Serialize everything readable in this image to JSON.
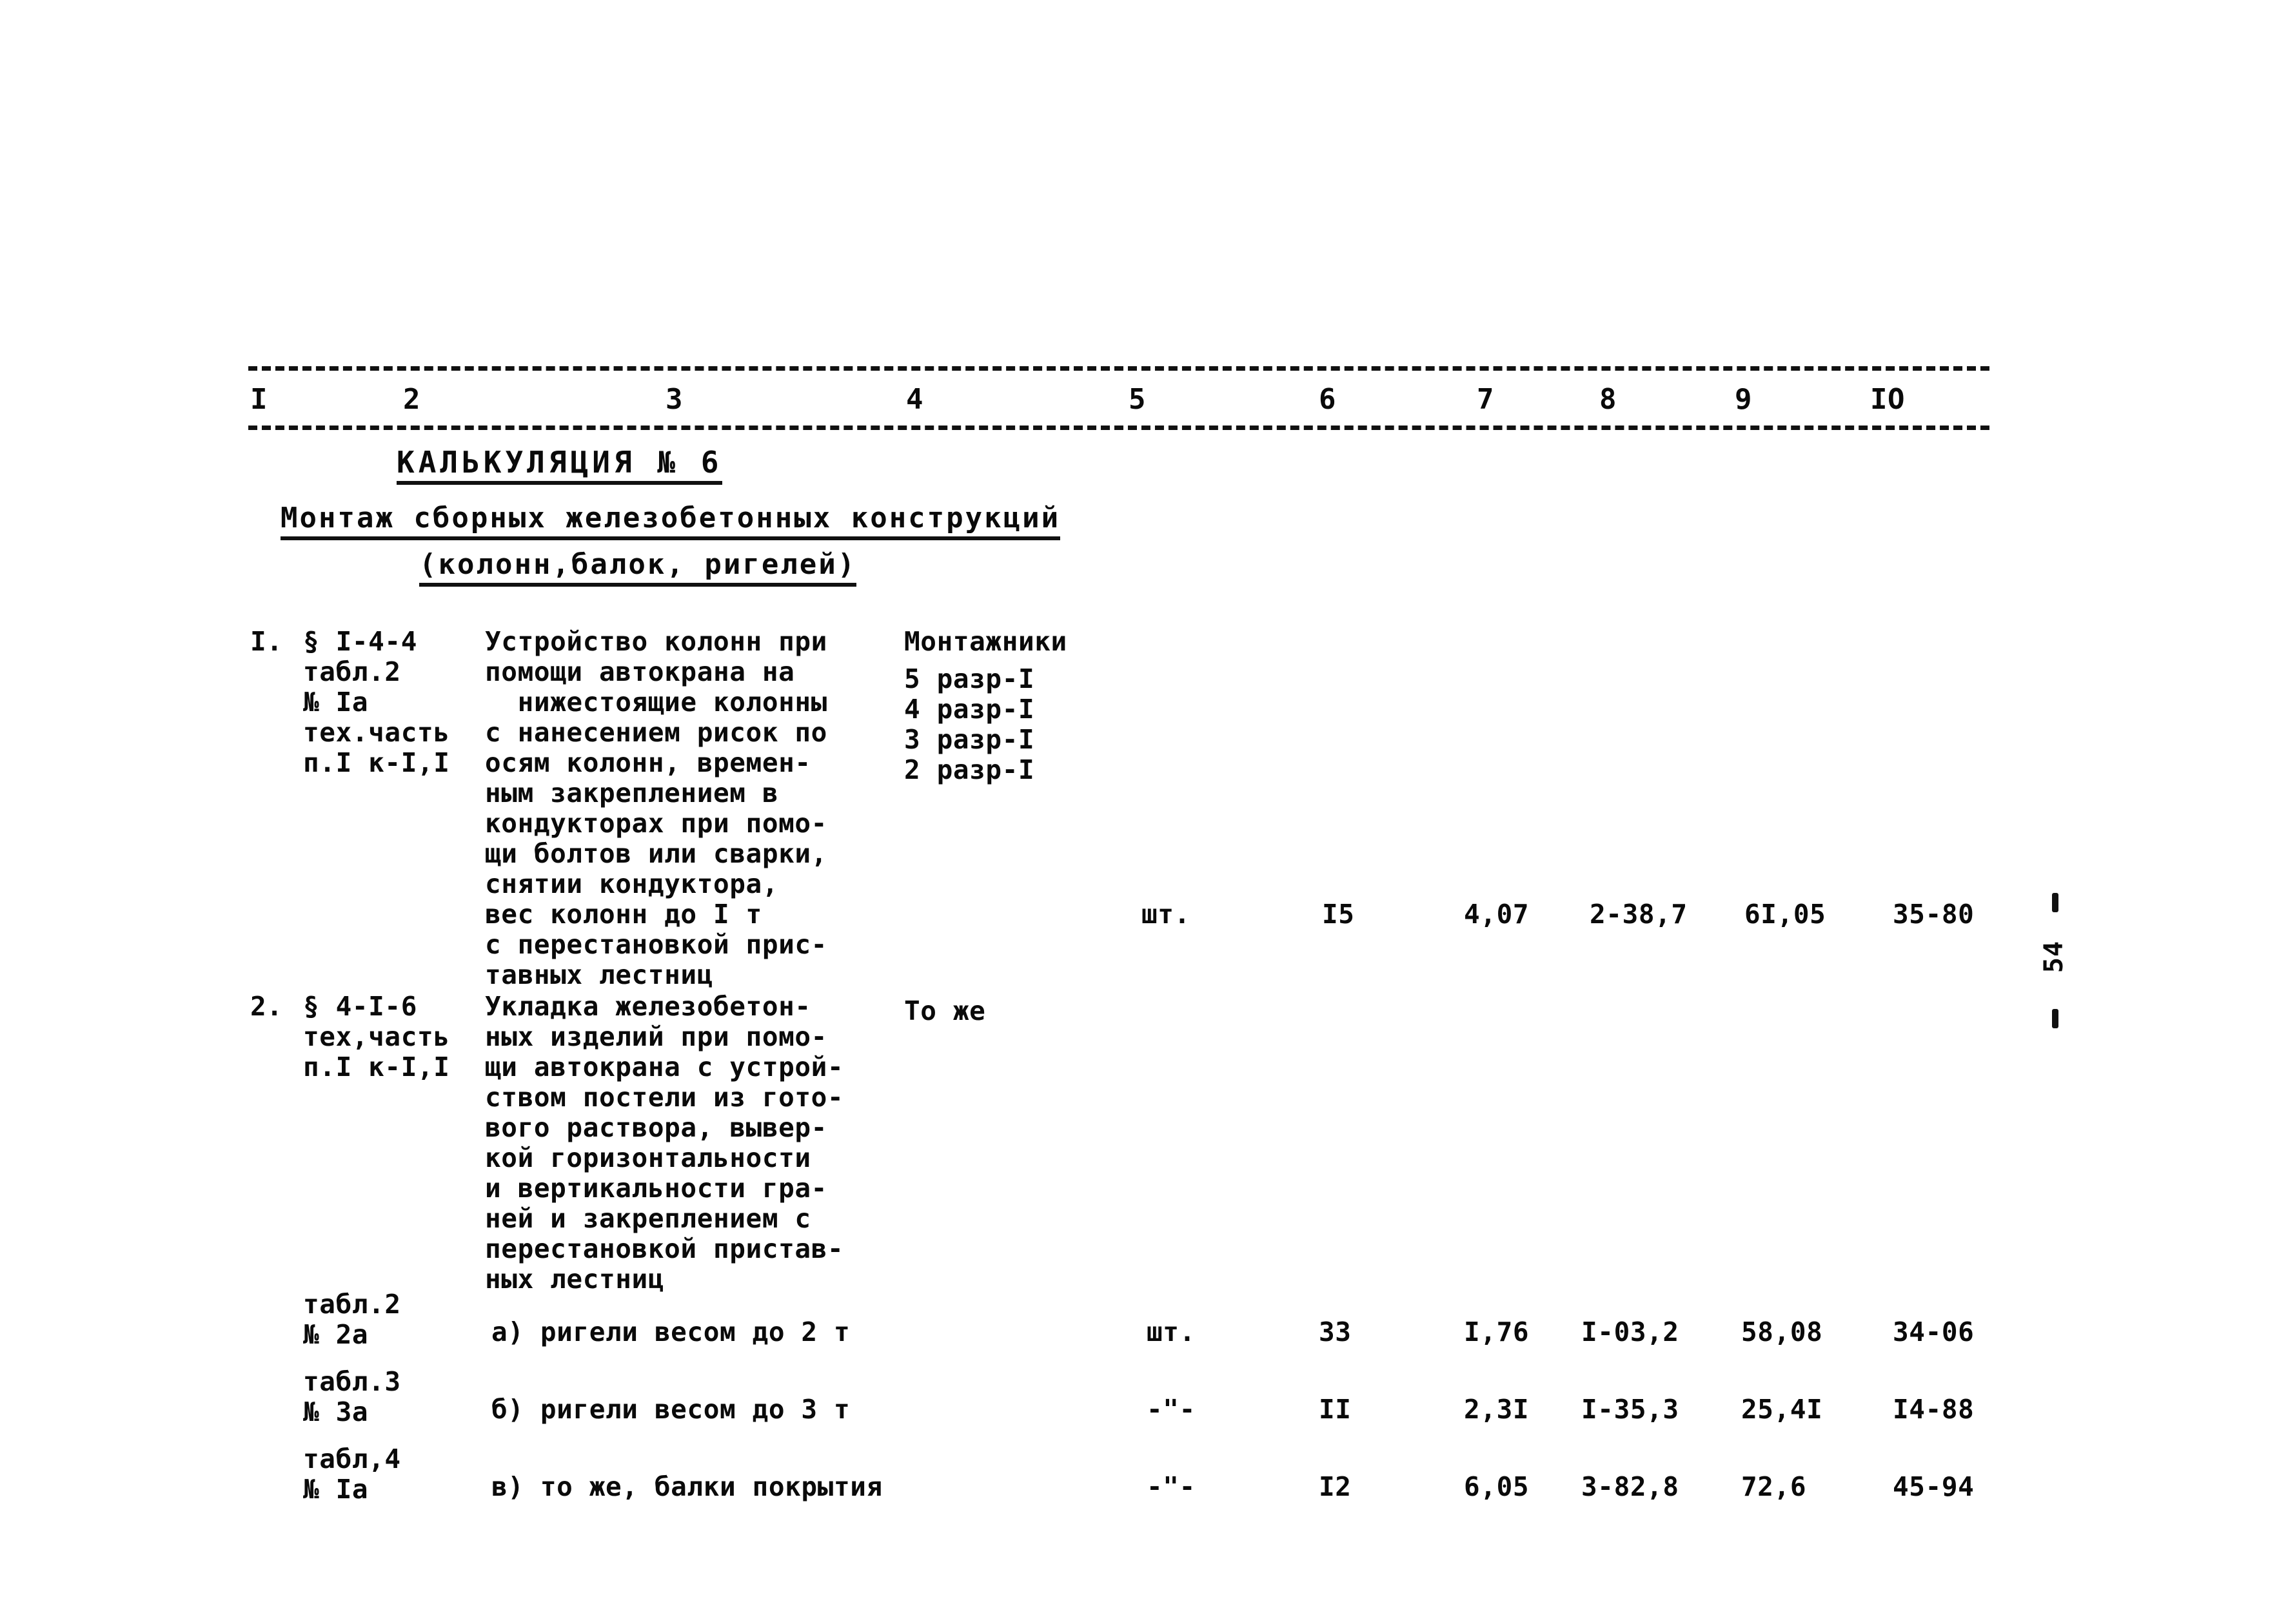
{
  "document": {
    "page_marker": "54",
    "column_numbers": [
      "I",
      "2",
      "3",
      "4",
      "5",
      "6",
      "7",
      "8",
      "9",
      "IO"
    ],
    "headings": {
      "calculation": "КАЛЬКУЛЯЦИЯ  № 6",
      "main_title": "Монтаж сборных железобетонных конструкций",
      "sub_title": "(колонн,балок, ригелей)"
    }
  },
  "rows": [
    {
      "number": "I.",
      "refs": [
        "§ I-4-4",
        "табл.2",
        "№ Iа",
        "тех.часть",
        "п.I к-I,I"
      ],
      "description": [
        "Устройство колонн при",
        "помощи автокрана на",
        "  нижестоящие колонны",
        "с нанесением рисок по",
        "осям колонн, времен-",
        "ным закреплением в",
        "кондукторах при помо-",
        "щи болтов или сварки,",
        "снятии кондуктора,",
        "вес колонн до I т",
        "с перестановкой прис-",
        "тавных лестниц"
      ],
      "workers_title": "Монтажники",
      "workers": [
        "5 разр-I",
        "4 разр-I",
        "3 разр-I",
        "2 разр-I"
      ],
      "unit": "шт.",
      "quantity": "I5",
      "norm_time": "4,07",
      "rate": "2-38,7",
      "total_time": "6I,05",
      "total_sum": "35-80"
    },
    {
      "number": "2.",
      "refs": [
        "§ 4-I-6",
        "тех,часть",
        "п.I к-I,I"
      ],
      "description": [
        "Укладка железобетон-",
        "ных изделий при помо-",
        "щи автокрана с устрой-",
        "ством постели из гото-",
        "вого раствора, вывер-",
        "кой горизонтальности",
        "и вертикальности гра-",
        "ней и закреплением с",
        "перестановкой пристав-",
        "ных лестниц"
      ],
      "workers_title": "То же",
      "subrows": [
        {
          "refs": [
            "табл.2",
            "№ 2а"
          ],
          "description": "а) ригели весом до 2 т",
          "unit": "шт.",
          "quantity": "33",
          "norm_time": "I,76",
          "rate": "I-03,2",
          "total_time": "58,08",
          "total_sum": "34-06"
        },
        {
          "refs": [
            "табл.3",
            "№ 3а"
          ],
          "description": "б) ригели весом до 3 т",
          "unit": "-\"-",
          "quantity": "II",
          "norm_time": "2,3I",
          "rate": "I-35,3",
          "total_time": "25,4I",
          "total_sum": "I4-88"
        },
        {
          "refs": [
            "табл,4",
            "№ Iа"
          ],
          "description": "в) то же, балки покрытия",
          "unit": "-\"-",
          "quantity": "I2",
          "norm_time": "6,05",
          "rate": "3-82,8",
          "total_time": "72,6",
          "total_sum": "45-94"
        }
      ]
    }
  ]
}
